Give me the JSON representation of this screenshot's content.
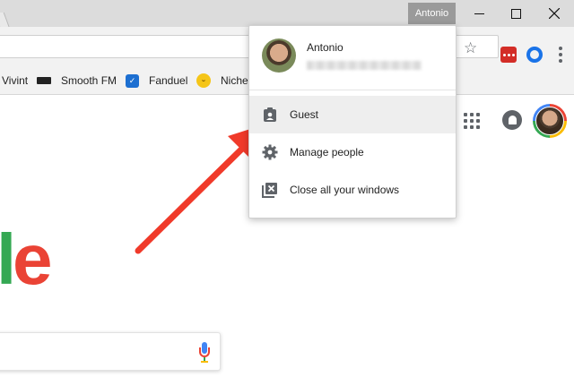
{
  "titlebar": {
    "profile_name": "Antonio"
  },
  "toolbar": {
    "star_icon": "star-icon",
    "extensions": [
      "lastpass-icon",
      "blue-ring-icon"
    ],
    "menu_icon": "kebab-menu-icon"
  },
  "bookmarks": [
    {
      "label": "Vivint",
      "icon": ""
    },
    {
      "label": "Smooth FM",
      "icon": "radio-icon"
    },
    {
      "label": "Fanduel",
      "icon": "shield-icon"
    },
    {
      "label": "Niche",
      "icon": "smiley-icon"
    }
  ],
  "page": {
    "logo_fragment_1": "l",
    "logo_fragment_2": "e"
  },
  "profile_menu": {
    "name": "Antonio",
    "items": [
      {
        "label": "Guest",
        "icon": "guest-badge-icon"
      },
      {
        "label": "Manage people",
        "icon": "gear-icon"
      },
      {
        "label": "Close all your windows",
        "icon": "close-windows-icon"
      }
    ]
  },
  "colors": {
    "accent_red": "#ea4335",
    "green": "#34a853",
    "blue": "#4285f4",
    "arrow": "#f03a2a"
  }
}
